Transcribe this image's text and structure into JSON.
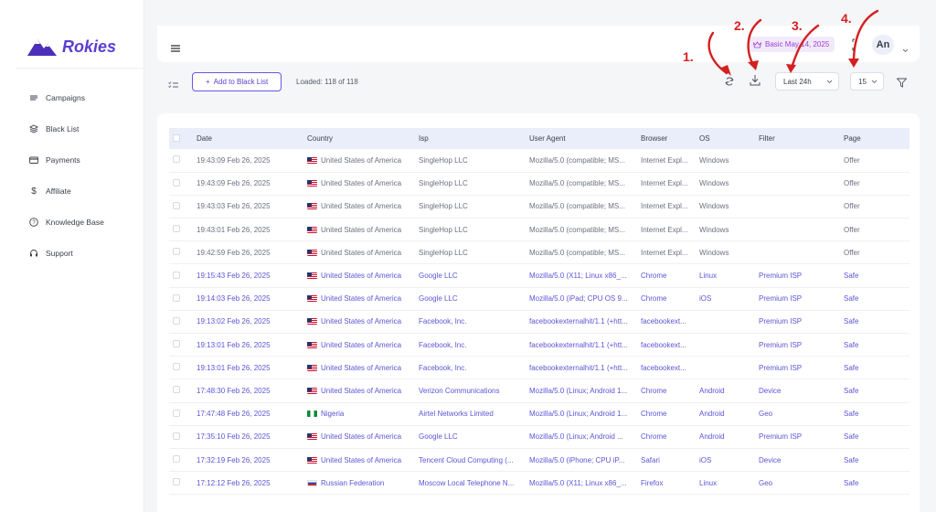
{
  "app": {
    "brand": "Rokies"
  },
  "sidebar": {
    "items": [
      {
        "label": "Campaigns",
        "icon": "list-lines-icon"
      },
      {
        "label": "Black List",
        "icon": "layers-icon"
      },
      {
        "label": "Payments",
        "icon": "credit-card-icon"
      },
      {
        "label": "Affiliate",
        "icon": "dollar-icon"
      },
      {
        "label": "Knowledge Base",
        "icon": "help-circle-icon"
      },
      {
        "label": "Support",
        "icon": "headset-icon"
      }
    ]
  },
  "header": {
    "plan_badge": "Basic May 14, 2025",
    "avatar": "An"
  },
  "toolbar": {
    "add_label": "Add to Black List",
    "loaded": "Loaded: 118 of 118",
    "range": "Last 24h",
    "count": "15"
  },
  "annotations": [
    "1.",
    "2.",
    "3.",
    "4."
  ],
  "colors": {
    "accent": "#5b3fd1",
    "annotation": "#d42020",
    "link": "#5b55d6"
  },
  "table": {
    "columns": [
      "Date",
      "Country",
      "Isp",
      "User Agent",
      "Browser",
      "OS",
      "Filter",
      "Page"
    ],
    "rows": [
      {
        "style": "muted",
        "flag": "us",
        "cells": [
          "19:43:09 Feb 26, 2025",
          "United States of America",
          "SingleHop LLC",
          "Mozilla/5.0 (compatible; MS...",
          "Internet Expl...",
          "Windows",
          "",
          "Offer"
        ]
      },
      {
        "style": "muted",
        "flag": "us",
        "cells": [
          "19:43:09 Feb 26, 2025",
          "United States of America",
          "SingleHop LLC",
          "Mozilla/5.0 (compatible; MS...",
          "Internet Expl...",
          "Windows",
          "",
          "Offer"
        ]
      },
      {
        "style": "muted",
        "flag": "us",
        "cells": [
          "19:43:03 Feb 26, 2025",
          "United States of America",
          "SingleHop LLC",
          "Mozilla/5.0 (compatible; MS...",
          "Internet Expl...",
          "Windows",
          "",
          "Offer"
        ]
      },
      {
        "style": "muted",
        "flag": "us",
        "cells": [
          "19:43:01 Feb 26, 2025",
          "United States of America",
          "SingleHop LLC",
          "Mozilla/5.0 (compatible; MS...",
          "Internet Expl...",
          "Windows",
          "",
          "Offer"
        ]
      },
      {
        "style": "muted",
        "flag": "us",
        "cells": [
          "19:42:59 Feb 26, 2025",
          "United States of America",
          "SingleHop LLC",
          "Mozilla/5.0 (compatible; MS...",
          "Internet Expl...",
          "Windows",
          "",
          "Offer"
        ]
      },
      {
        "style": "link",
        "flag": "us",
        "cells": [
          "19:15:43 Feb 26, 2025",
          "United States of America",
          "Google LLC",
          "Mozilla/5.0 (X11; Linux x86_...",
          "Chrome",
          "Linux",
          "Premium ISP",
          "Safe"
        ]
      },
      {
        "style": "link",
        "flag": "us",
        "cells": [
          "19:14:03 Feb 26, 2025",
          "United States of America",
          "Google LLC",
          "Mozilla/5.0 (iPad; CPU OS 9...",
          "Chrome",
          "iOS",
          "Premium ISP",
          "Safe"
        ]
      },
      {
        "style": "link",
        "flag": "us",
        "cells": [
          "19:13:02 Feb 26, 2025",
          "United States of America",
          "Facebook, Inc.",
          "facebookexternalhit/1.1 (+htt...",
          "facebookext...",
          "",
          "Premium ISP",
          "Safe"
        ]
      },
      {
        "style": "link",
        "flag": "us",
        "cells": [
          "19:13:01 Feb 26, 2025",
          "United States of America",
          "Facebook, Inc.",
          "facebookexternalhit/1.1 (+htt...",
          "facebookext...",
          "",
          "Premium ISP",
          "Safe"
        ]
      },
      {
        "style": "link",
        "flag": "us",
        "cells": [
          "19:13:01 Feb 26, 2025",
          "United States of America",
          "Facebook, Inc.",
          "facebookexternalhit/1.1 (+htt...",
          "facebookext...",
          "",
          "Premium ISP",
          "Safe"
        ]
      },
      {
        "style": "link",
        "flag": "us",
        "cells": [
          "17:48:30 Feb 26, 2025",
          "United States of America",
          "Verizon Communications",
          "Mozilla/5.0 (Linux; Android 1...",
          "Chrome",
          "Android",
          "Device",
          "Safe"
        ]
      },
      {
        "style": "link",
        "flag": "ng",
        "cells": [
          "17:47:48 Feb 26, 2025",
          "Nigeria",
          "Airtel Networks Limited",
          "Mozilla/5.0 (Linux; Android 1...",
          "Chrome",
          "Android",
          "Geo",
          "Safe"
        ]
      },
      {
        "style": "link",
        "flag": "us",
        "cells": [
          "17:35:10 Feb 26, 2025",
          "United States of America",
          "Google LLC",
          "Mozilla/5.0 (Linux; Android ...",
          "Chrome",
          "Android",
          "Premium ISP",
          "Safe"
        ]
      },
      {
        "style": "link",
        "flag": "us",
        "cells": [
          "17:32:19 Feb 26, 2025",
          "United States of America",
          "Tencent Cloud Computing (...",
          "Mozilla/5.0 (iPhone; CPU iP...",
          "Safari",
          "iOS",
          "Device",
          "Safe"
        ]
      },
      {
        "style": "link",
        "flag": "ru",
        "cells": [
          "17:12:12 Feb 26, 2025",
          "Russian Federation",
          "Moscow Local Telephone N...",
          "Mozilla/5.0 (X11; Linux x86_...",
          "Firefox",
          "Linux",
          "Geo",
          "Safe"
        ]
      }
    ]
  }
}
